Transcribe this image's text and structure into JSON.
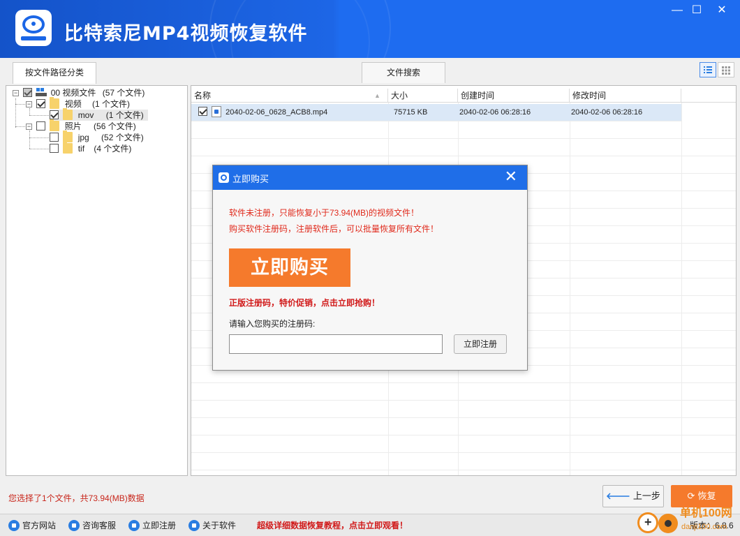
{
  "app": {
    "title": "比特索尼MP4视频恢复软件",
    "window_controls": {
      "minimize": "—",
      "maximize": "☐",
      "close": "✕"
    }
  },
  "tabs": [
    {
      "label": "按文件路径分类",
      "active": true
    },
    {
      "label": "文件搜索",
      "active": false
    }
  ],
  "view_modes": [
    "list-view-icon",
    "grid-view-icon"
  ],
  "tree": [
    {
      "name": "00 视频文件",
      "count": "(57 个文件)",
      "state": "partial",
      "expanded": true,
      "level": 0
    },
    {
      "name": "视频",
      "count": "(1 个文件)",
      "state": "checked",
      "expanded": true,
      "level": 1
    },
    {
      "name": "mov",
      "count": "(1 个文件)",
      "state": "checked",
      "level": 2,
      "selected": true
    },
    {
      "name": "照片",
      "count": "(56 个文件)",
      "state": "unchecked",
      "expanded": true,
      "level": 1
    },
    {
      "name": "jpg",
      "count": "(52 个文件)",
      "state": "unchecked",
      "level": 2
    },
    {
      "name": "tif",
      "count": "(4 个文件)",
      "state": "unchecked",
      "level": 2
    }
  ],
  "file_list": {
    "columns": [
      "名称",
      "大小",
      "创建时间",
      "修改时间"
    ],
    "rows": [
      {
        "name": "2040-02-06_0628_ACB8.mp4",
        "size": "75715 KB",
        "created": "2040-02-06 06:28:16",
        "modified": "2040-02-06 06:28:16",
        "checked": true
      }
    ]
  },
  "dialog": {
    "title": "立即购买",
    "close": "✕",
    "warning_line1": "软件未注册，只能恢复小于73.94(MB)的视频文件！",
    "warning_line2": "购买软件注册码，注册软件后，可以批量恢复所有文件！",
    "buy_button": "立即购买",
    "promo": "正版注册码，特价促销，点击立即抢购！",
    "prompt": "请输入您购买的注册码:",
    "code_value": "",
    "register_button": "立即注册"
  },
  "status": {
    "selection": "您选择了1个文件，共73.94(MB)数据"
  },
  "actions": {
    "back": "上一步",
    "back_arrow": "🡐",
    "recover": "恢复",
    "recover_icon": "⟳"
  },
  "bottom_bar": {
    "items": [
      "官方网站",
      "咨询客服",
      "立即注册",
      "关于软件"
    ],
    "tutorial_link": "超级详细数据恢复教程，点击立即观看！",
    "version": "版本：6.8.6"
  },
  "watermark": {
    "text": "单机100网",
    "sub": "danji100.com"
  },
  "colors": {
    "title_blue": "#1f6ee8",
    "accent_orange": "#f57a2c",
    "warning_red": "#e02a1c"
  }
}
